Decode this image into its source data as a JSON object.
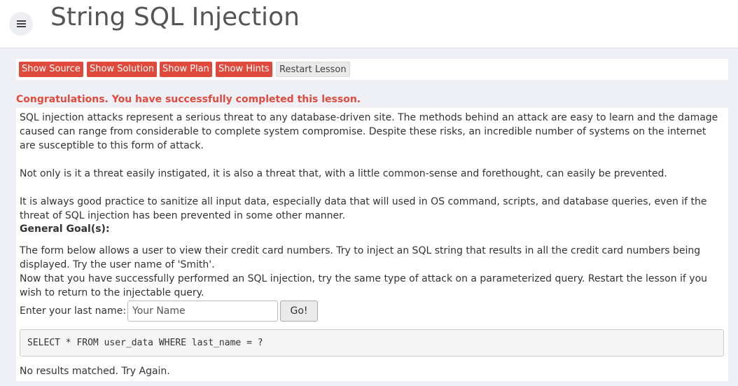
{
  "header": {
    "menu_icon": "hamburger-menu-icon",
    "title": "String SQL Injection"
  },
  "toolbar": {
    "show_source": "Show Source",
    "show_solution": "Show Solution",
    "show_plan": "Show Plan",
    "show_hints": "Show Hints",
    "restart_lesson": "Restart Lesson",
    "accent_color": "#e04a3d"
  },
  "lesson": {
    "congrats": "Congratulations. You have successfully completed this lesson.",
    "intro_p1": "SQL injection attacks represent a serious threat to any database-driven site. The methods behind an attack are easy to learn and the damage caused can range from considerable to complete system compromise. Despite these risks, an incredible number of systems on the internet are susceptible to this form of attack.",
    "intro_p2": "Not only is it a threat easily instigated, it is also a threat that, with a little common-sense and forethought, can easily be prevented.",
    "intro_p3": "It is always good practice to sanitize all input data, especially data that will used in OS command, scripts, and database queries, even if the threat of SQL injection has been prevented in some other manner.",
    "goal_heading": "General Goal(s):",
    "goal_p1": "The form below allows a user to view their credit card numbers. Try to inject an SQL string that results in all the credit card numbers being displayed. Try the user name of 'Smith'.",
    "goal_p2": "Now that you have successfully performed an SQL injection, try the same type of attack on a parameterized query. Restart the lesson if you wish to return to the injectable query."
  },
  "form": {
    "label": "Enter your last name:",
    "input_placeholder": "Your Name",
    "input_value": "",
    "go_label": "Go!"
  },
  "query": "SELECT * FROM user_data WHERE last_name = ?",
  "result_message": "No results matched. Try Again."
}
